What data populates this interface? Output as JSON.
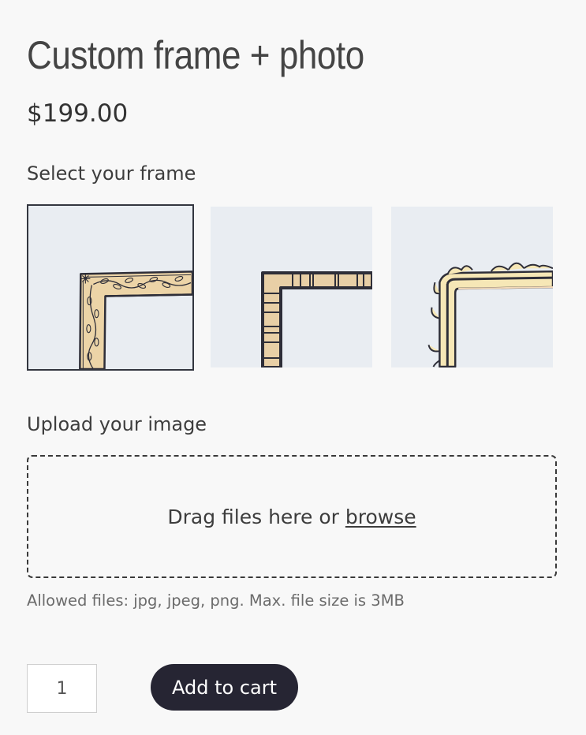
{
  "product": {
    "title": "Custom frame + photo",
    "price": "$199.00"
  },
  "frame_selector": {
    "label": "Select your frame",
    "options": [
      {
        "name": "ornate-vine-frame",
        "selected": true
      },
      {
        "name": "segmented-block-frame",
        "selected": false
      },
      {
        "name": "spiky-leaf-frame",
        "selected": false
      }
    ]
  },
  "upload": {
    "label": "Upload your image",
    "drop_text": "Drag files here or ",
    "browse_label": "browse",
    "allowed_text": "Allowed files: jpg, jpeg, png. Max. file size is 3MB"
  },
  "cart": {
    "quantity": "1",
    "add_label": "Add to cart"
  },
  "colors": {
    "background": "#f8f8f8",
    "tile_background": "#e9edf2",
    "frame_fill": "#e8cfa6",
    "frame_outline": "#2e2e38",
    "button_background": "#262533",
    "button_text": "#ffffff"
  }
}
